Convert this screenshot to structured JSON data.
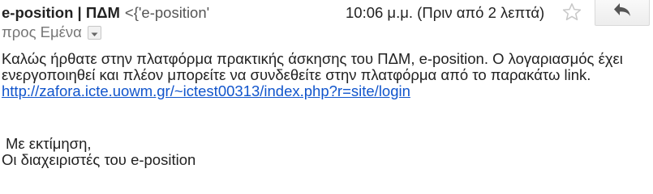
{
  "message": {
    "sender_name": "e-position | ΠΔΜ",
    "sender_email": "<{'e-position'",
    "date": "10:06 μ.μ. (Πριν από 2 λεπτά)",
    "to_label": "προς Εμένα",
    "body_text": "Καλώς ήρθατε στην πλατφόρμα πρακτικής άσκησης του ΠΔΜ, e-position. Ο λογαριασμός έχει ενεργοποιηθεί και πλέον μπορείτε να συνδεθείτε στην πλατφόρμα από το παρακάτω link.",
    "link": "http://zafora.icte.uowm.gr/~ictest00313/index.php?r=site/login",
    "signature_greeting": "Με εκτίμηση,",
    "signature_name": "Οι διαχειριστές του e-position"
  },
  "icons": {
    "star": "star-icon",
    "reply": "reply-icon",
    "details": "chevron-down-icon"
  },
  "colors": {
    "link": "#1155cc",
    "secondary_text": "#777777",
    "star_outline": "#c8c8c8",
    "reply_arrow": "#555555"
  }
}
